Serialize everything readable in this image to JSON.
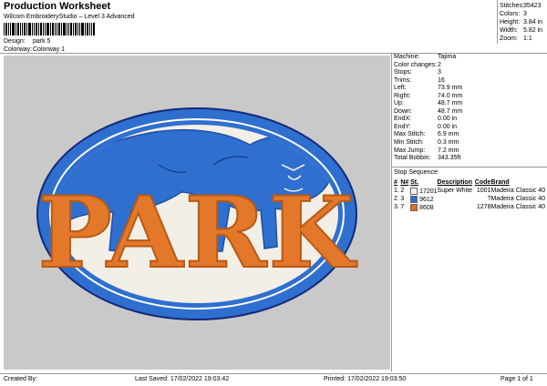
{
  "header": {
    "title": "Production Worksheet",
    "software": "Wilcom EmbroideryStudio – Level 3 Advanced",
    "design_label": "Design:",
    "design_value": "park 5",
    "colorway_label": "Colorway:",
    "colorway_value": "Colorway 1"
  },
  "summary": [
    {
      "label": "Stitches:",
      "value": "35423"
    },
    {
      "label": "Colors:",
      "value": "3"
    },
    {
      "label": "Height:",
      "value": "3.84 in"
    },
    {
      "label": "Width:",
      "value": "5.82 in"
    },
    {
      "label": "Zoom:",
      "value": "1:1"
    }
  ],
  "info": [
    {
      "label": "Machine:",
      "value": "Tajima"
    },
    {
      "label": "Color changes:",
      "value": "2"
    },
    {
      "label": "Stops:",
      "value": "3"
    },
    {
      "label": "Trims:",
      "value": "16"
    },
    {
      "label": "Left:",
      "value": "73.9 mm"
    },
    {
      "label": "Right:",
      "value": "74.0 mm"
    },
    {
      "label": "Up:",
      "value": "48.7 mm"
    },
    {
      "label": "Down:",
      "value": "48.7 mm"
    },
    {
      "label": "EndX:",
      "value": "0.00 in"
    },
    {
      "label": "EndY:",
      "value": "0.00 in"
    },
    {
      "label": "Max Stitch:",
      "value": "6.9 mm"
    },
    {
      "label": "Min Stitch:",
      "value": "0.3 mm"
    },
    {
      "label": "Max Jump:",
      "value": "7.2 mm"
    },
    {
      "label": "Total Bobbin:",
      "value": "343.35ft"
    }
  ],
  "stop_sequence": {
    "title": "Stop Sequence:",
    "columns": [
      "#",
      "N#",
      "St.",
      "Description",
      "Code",
      "Brand"
    ],
    "rows": [
      {
        "num": "1.",
        "n": "2",
        "color": "#f2f2f2",
        "st": "17201",
        "description": "Super White",
        "code": "1001",
        "brand": "Madeira Classic 40"
      },
      {
        "num": "2.",
        "n": "3",
        "color": "#2f6fd0",
        "st": "9612",
        "description": "",
        "code": "?",
        "brand": "Madeira Classic 40"
      },
      {
        "num": "3.",
        "n": "7",
        "color": "#e26f1d",
        "st": "8608",
        "description": "",
        "code": "1278",
        "brand": "Madeira Classic 40"
      }
    ]
  },
  "design": {
    "text": "PARK",
    "colors": {
      "blue": "#2f6fd0",
      "dark_blue": "#1f4fa8",
      "orange": "#e3782a",
      "white": "#f4f2ea",
      "navy": "#13297a"
    }
  },
  "footer": {
    "created_by": "Created By:",
    "last_saved": "Last Saved: 17/02/2022 19:03:42",
    "printed": "Printed: 17/02/2022 19:03:50",
    "page": "Page 1 of 1"
  }
}
